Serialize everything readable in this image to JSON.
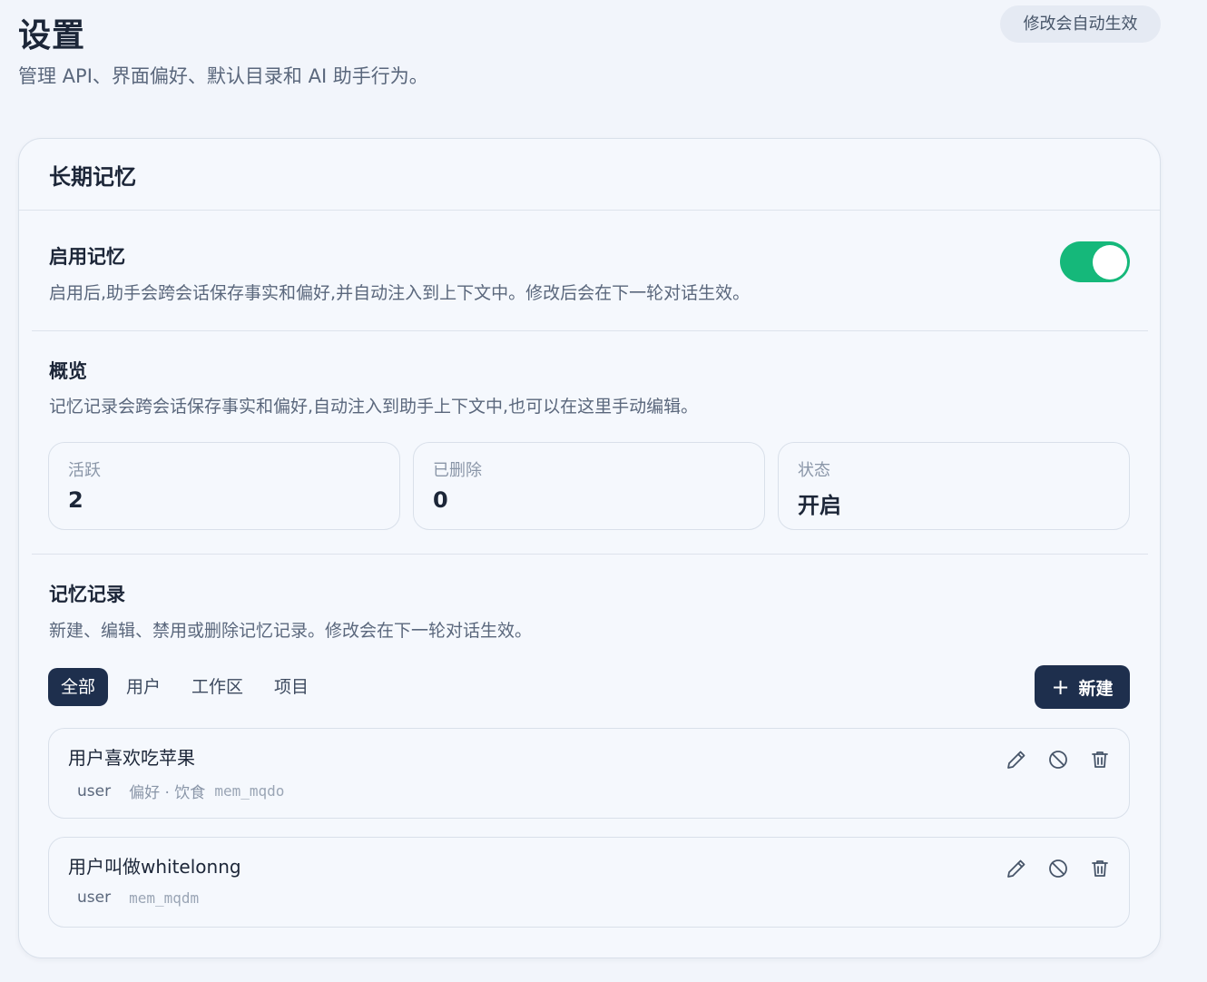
{
  "page": {
    "title": "设置",
    "subtitle": "管理 API、界面偏好、默认目录和 AI 助手行为。",
    "auto_badge": "修改会自动生效"
  },
  "card": {
    "title": "长期记忆"
  },
  "enable_memory": {
    "title": "启用记忆",
    "description": "启用后,助手会跨会话保存事实和偏好,并自动注入到上下文中。修改后会在下一轮对话生效。",
    "enabled": true
  },
  "overview": {
    "title": "概览",
    "description": "记忆记录会跨会话保存事实和偏好,自动注入到助手上下文中,也可以在这里手动编辑。",
    "stats": [
      {
        "label": "活跃",
        "value": "2"
      },
      {
        "label": "已删除",
        "value": "0"
      },
      {
        "label": "状态",
        "value": "开启"
      }
    ]
  },
  "records": {
    "title": "记忆记录",
    "description": "新建、编辑、禁用或删除记忆记录。修改会在下一轮对话生效。",
    "tabs": [
      {
        "label": "全部",
        "active": true
      },
      {
        "label": "用户",
        "active": false
      },
      {
        "label": "工作区",
        "active": false
      },
      {
        "label": "项目",
        "active": false
      }
    ],
    "new_label": "新建",
    "items": [
      {
        "text": "用户喜欢吃苹果",
        "scope": "user",
        "tags": "偏好 · 饮食",
        "id": "mem_mqdo"
      },
      {
        "text": "用户叫做whitelonng",
        "scope": "user",
        "tags": "",
        "id": "mem_mqdm"
      }
    ]
  },
  "colors": {
    "accent_dark": "#1e2f4d",
    "toggle_on": "#15b87a",
    "background": "#f2f5fb"
  },
  "icons": [
    "plus-icon",
    "pencil-icon",
    "disable-icon",
    "trash-icon"
  ]
}
